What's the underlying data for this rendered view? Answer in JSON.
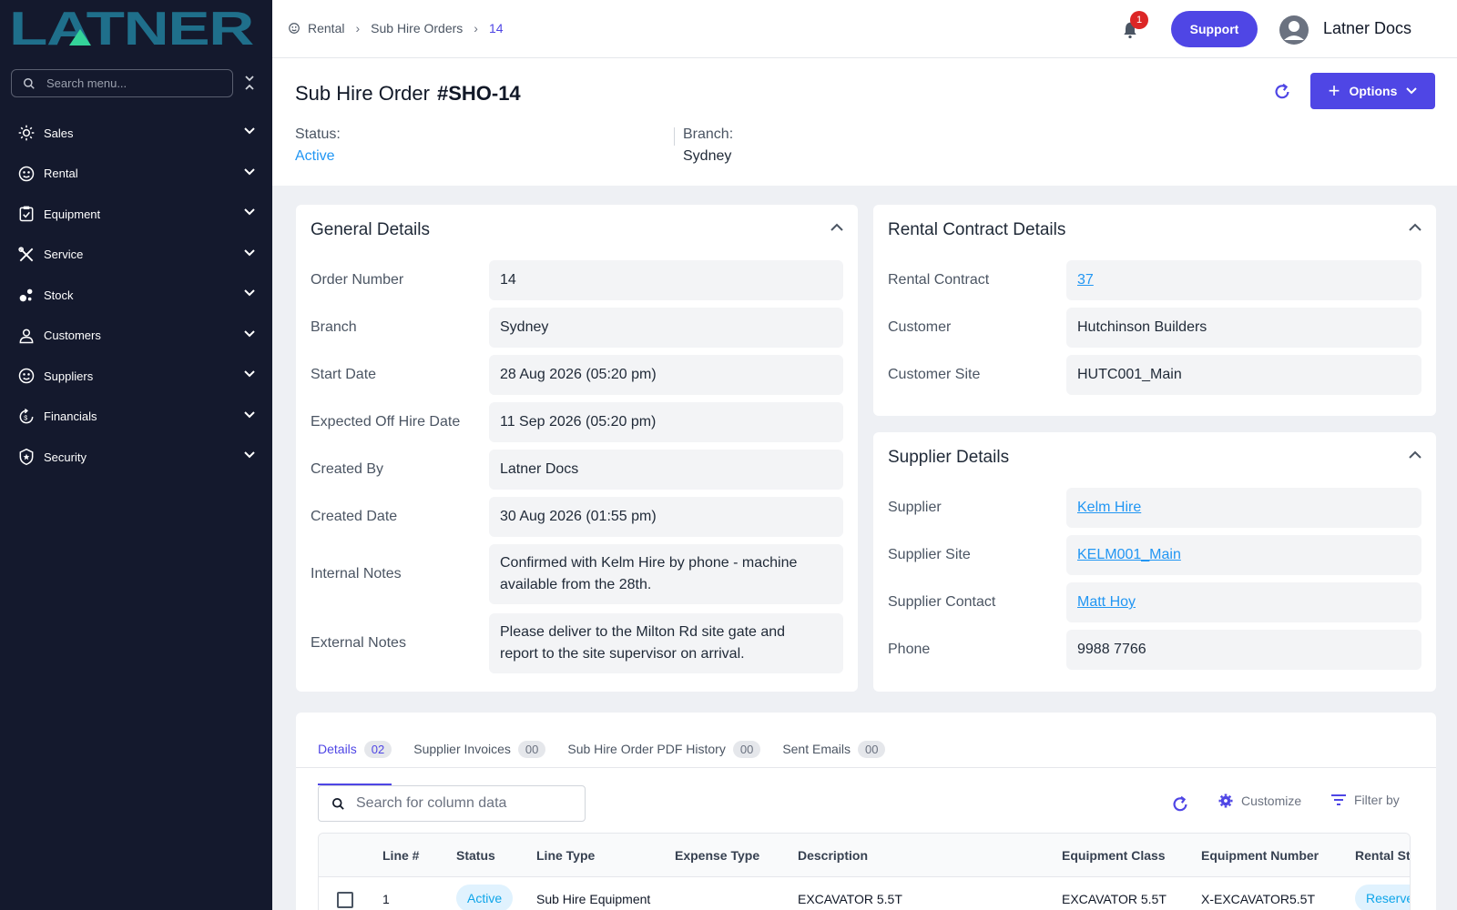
{
  "app": {
    "logo_text": "LATNER"
  },
  "sidebar": {
    "search_placeholder": "Search menu...",
    "items": [
      {
        "label": "Sales",
        "icon": "sales-icon"
      },
      {
        "label": "Rental",
        "icon": "rental-icon"
      },
      {
        "label": "Equipment",
        "icon": "equipment-icon"
      },
      {
        "label": "Service",
        "icon": "service-icon"
      },
      {
        "label": "Stock",
        "icon": "stock-icon"
      },
      {
        "label": "Customers",
        "icon": "customers-icon"
      },
      {
        "label": "Suppliers",
        "icon": "suppliers-icon"
      },
      {
        "label": "Financials",
        "icon": "financials-icon"
      },
      {
        "label": "Security",
        "icon": "security-icon"
      }
    ]
  },
  "topbar": {
    "breadcrumb": [
      "Rental",
      "Sub Hire Orders",
      "14"
    ],
    "notification_count": "1",
    "support_label": "Support",
    "user_name": "Latner Docs"
  },
  "header": {
    "title": "Sub Hire Order",
    "order_id": "#SHO-14",
    "options_label": "Options",
    "status_label": "Status:",
    "status_value": "Active",
    "branch_label": "Branch:",
    "branch_value": "Sydney"
  },
  "general": {
    "title": "General Details",
    "rows": [
      {
        "label": "Order Number",
        "value": "14"
      },
      {
        "label": "Branch",
        "value": "Sydney"
      },
      {
        "label": "Start Date",
        "value": "28 Aug 2026 (05:20 pm)"
      },
      {
        "label": "Expected Off Hire Date",
        "value": "11 Sep 2026 (05:20 pm)"
      },
      {
        "label": "Created By",
        "value": "Latner Docs"
      },
      {
        "label": "Created Date",
        "value": "30 Aug 2026 (01:55 pm)"
      },
      {
        "label": "Internal Notes",
        "value": "Confirmed with Kelm Hire by phone - machine available from the 28th."
      },
      {
        "label": "External Notes",
        "value": "Please deliver to the Milton Rd site gate and report to the site supervisor on arrival."
      }
    ]
  },
  "rental_contract": {
    "title": "Rental Contract Details",
    "rows": [
      {
        "label": "Rental Contract",
        "value": "37"
      },
      {
        "label": "Customer",
        "value": "Hutchinson Builders"
      },
      {
        "label": "Customer Site",
        "value": "HUTC001_Main"
      }
    ]
  },
  "supplier": {
    "title": "Supplier Details",
    "rows": [
      {
        "label": "Supplier",
        "value": "Kelm Hire"
      },
      {
        "label": "Supplier Site",
        "value": "KELM001_Main"
      },
      {
        "label": "Supplier Contact",
        "value": "Matt Hoy"
      },
      {
        "label": "Phone",
        "value": "9988 7766"
      }
    ]
  },
  "tabs": [
    {
      "label": "Details",
      "count": "02"
    },
    {
      "label": "Supplier Invoices",
      "count": "00"
    },
    {
      "label": "Sub Hire Order PDF History",
      "count": "00"
    },
    {
      "label": "Sent Emails",
      "count": "00"
    }
  ],
  "table": {
    "search_placeholder": "Search for column data",
    "customize_label": "Customize",
    "filter_label": "Filter by",
    "columns": [
      "Line #",
      "Status",
      "Line Type",
      "Expense Type",
      "Description",
      "Equipment Class",
      "Equipment Number",
      "Rental Sta"
    ],
    "rows": [
      {
        "line": "1",
        "status": "Active",
        "line_type": "Sub Hire Equipment",
        "expense_type": "",
        "description": "EXCAVATOR 5.5T",
        "equipment_class": "EXCAVATOR 5.5T",
        "equipment_number": "X-EXCAVATOR5.5T",
        "rental_status": "Reserve"
      }
    ]
  }
}
